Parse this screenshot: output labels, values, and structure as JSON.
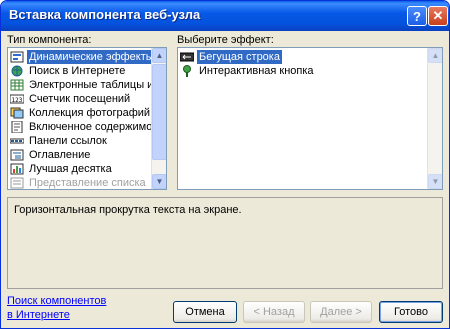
{
  "window": {
    "title": "Вставка компонента веб-узла"
  },
  "titlebar_buttons": {
    "help": "?",
    "close": "✕"
  },
  "component_type": {
    "label": "Тип компонента:",
    "items": [
      {
        "label": "Динамические эффекты",
        "icon": "dynamic-effects-icon",
        "selected": true
      },
      {
        "label": "Поиск в Интернете",
        "icon": "web-search-icon"
      },
      {
        "label": "Электронные таблицы и ди",
        "icon": "spreadsheet-icon"
      },
      {
        "label": "Счетчик посещений",
        "icon": "hit-counter-icon"
      },
      {
        "label": "Коллекция фотографий",
        "icon": "photo-gallery-icon"
      },
      {
        "label": "Включенное содержимое",
        "icon": "included-content-icon"
      },
      {
        "label": "Панели ссылок",
        "icon": "link-bar-icon"
      },
      {
        "label": "Оглавление",
        "icon": "table-of-contents-icon"
      },
      {
        "label": "Лучшая десятка",
        "icon": "top-ten-icon"
      },
      {
        "label": "Представление списка",
        "icon": "list-view-icon",
        "dimmed": true
      }
    ]
  },
  "effect": {
    "label": "Выберите эффект:",
    "items": [
      {
        "label": "Бегущая строка",
        "icon": "marquee-icon",
        "selected": true
      },
      {
        "label": "Интерактивная кнопка",
        "icon": "interactive-button-icon"
      }
    ]
  },
  "description": "Горизонтальная прокрутка текста на экране.",
  "link": {
    "line1": "Поиск компонентов",
    "line2": "в Интернете"
  },
  "buttons": {
    "cancel": "Отмена",
    "back": "< Назад",
    "next": "Далее >",
    "finish": "Готово"
  }
}
